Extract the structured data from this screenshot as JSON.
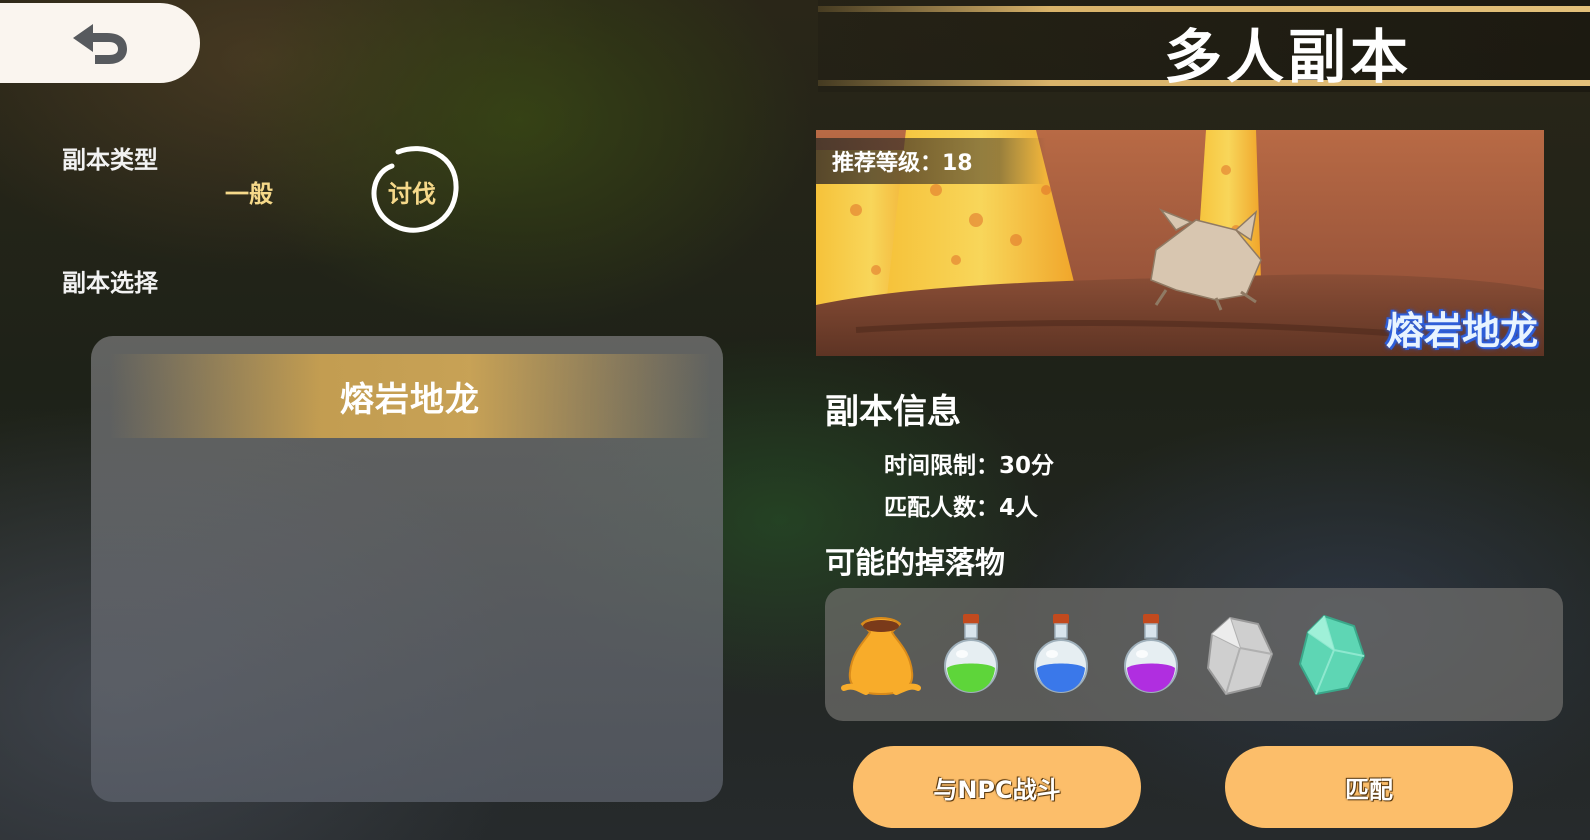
{
  "header": {
    "back_icon": "undo-arrow-icon",
    "title": "多人副本"
  },
  "left": {
    "type_label": "副本类型",
    "type_options": [
      {
        "label": "一般",
        "selected": false
      },
      {
        "label": "讨伐",
        "selected": true
      }
    ],
    "select_label": "副本选择",
    "dungeon_list": [
      {
        "name": "熔岩地龙",
        "selected": true
      }
    ]
  },
  "detail": {
    "banner": {
      "level_text": "推荐等级：18",
      "name": "熔岩地龙"
    },
    "info_title": "副本信息",
    "time_limit": "时间限制：30分",
    "party_size": "匹配人数：4人",
    "drops_title": "可能的掉落物",
    "drops": [
      {
        "icon": "sack-icon"
      },
      {
        "icon": "green-potion-icon"
      },
      {
        "icon": "blue-potion-icon"
      },
      {
        "icon": "purple-potion-icon"
      },
      {
        "icon": "silver-ore-icon"
      },
      {
        "icon": "teal-crystal-icon"
      }
    ]
  },
  "buttons": {
    "npc_battle": "与NPC战斗",
    "match": "匹配"
  },
  "colors": {
    "gold": "#d9b36a",
    "button": "#fcbe6a",
    "option_text": "#f6d98a"
  }
}
